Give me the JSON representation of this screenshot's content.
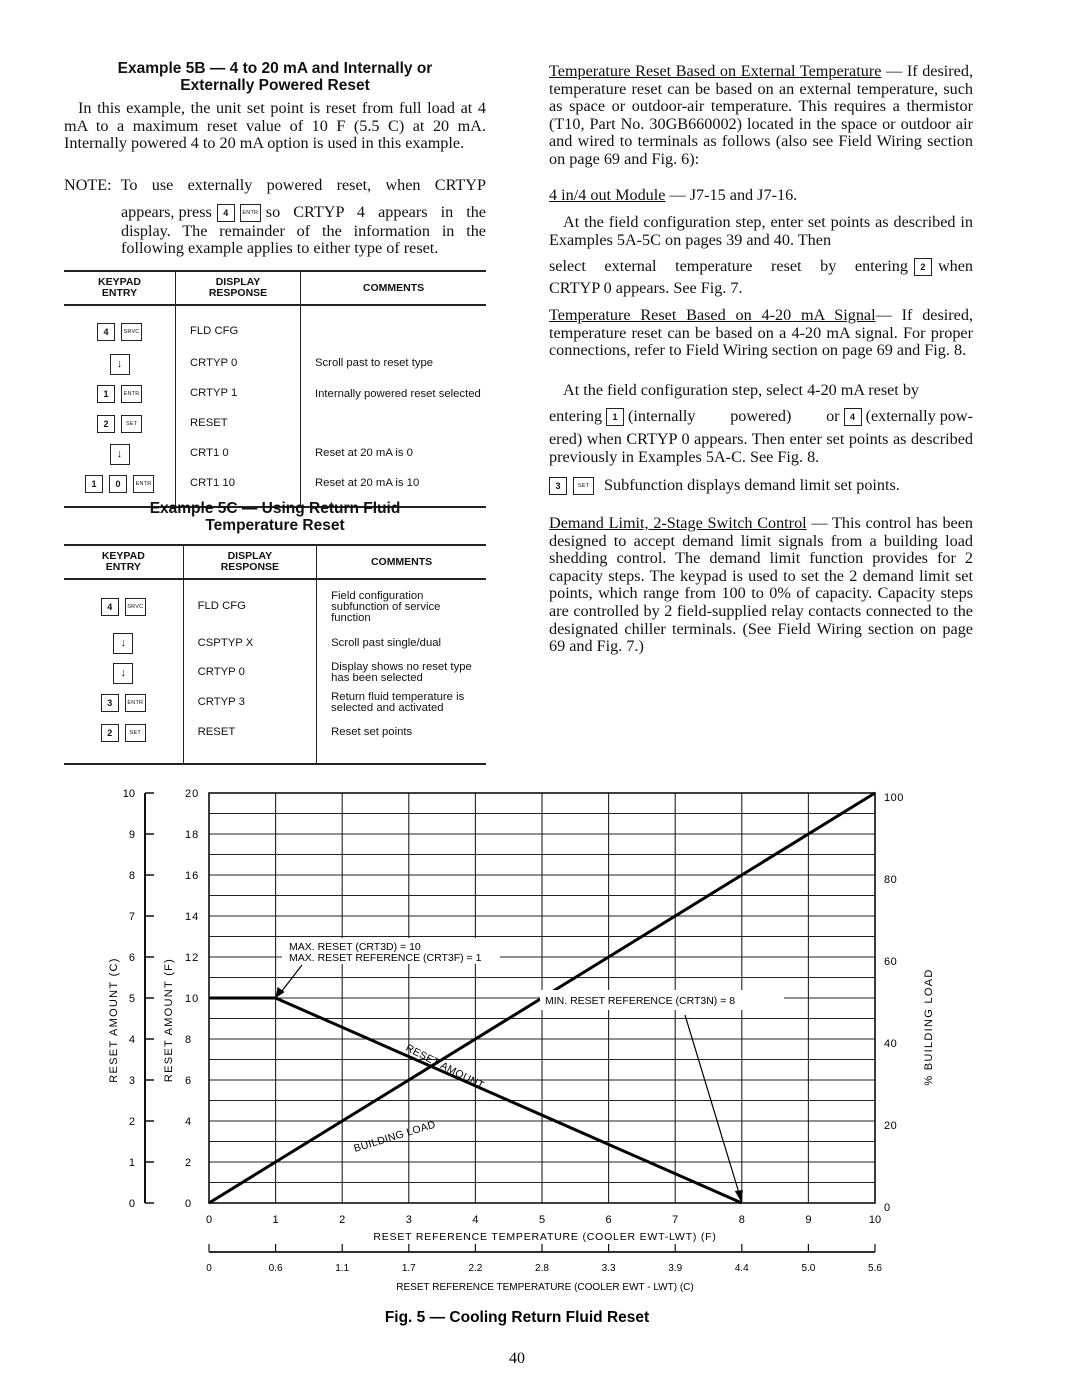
{
  "left": {
    "example5b": {
      "title_line1": "Example 5B — 4 to 20 mA and Internally or",
      "title_line2": "Externally Powered Reset",
      "para1": "In this example, the unit set point is reset from full load at 4 mA to a maximum reset value of 10 F (5.5 C) at 20 mA. Internally powered 4 to 20 mA option is used in this example.",
      "note_label": "NOTE:",
      "note_first": "To use externally powered reset, when CRTYP",
      "note_pre": "appears, press",
      "note_keys": [
        "4",
        "ENTR"
      ],
      "note_post": "so CRTYP 4 appears in the",
      "note_rest": "display. The remainder of the information in the following example applies to either type of reset.",
      "table": {
        "headers": [
          "KEYPAD\nENTRY",
          "DISPLAY\nRESPONSE",
          "COMMENTS"
        ],
        "header_lines": [
          [
            "KEYPAD",
            "ENTRY"
          ],
          [
            "DISPLAY",
            "RESPONSE"
          ],
          [
            "COMMENTS"
          ]
        ],
        "rows": [
          {
            "keys": [
              "4",
              "SRVC"
            ],
            "display": "FLD CFG",
            "comment": ""
          },
          {
            "keys": [
              "↓"
            ],
            "display": "CRTYP 0",
            "comment": "Scroll past to reset type"
          },
          {
            "keys": [
              "1",
              "ENTR"
            ],
            "display": "CRTYP 1",
            "comment": "Internally powered reset selected"
          },
          {
            "keys": [
              "2",
              "SET"
            ],
            "display": "RESET",
            "comment": ""
          },
          {
            "keys": [
              "↓"
            ],
            "display": "CRT1 0",
            "comment": "Reset at 20 mA is 0"
          },
          {
            "keys": [
              "1",
              "0",
              "ENTR"
            ],
            "display": "CRT1 10",
            "comment": "Reset at 20 mA is 10"
          }
        ]
      }
    },
    "example5c": {
      "title_line1": "Example 5C — Using Return Fluid",
      "title_line2": "Temperature Reset",
      "table": {
        "header_lines": [
          [
            "KEYPAD",
            "ENTRY"
          ],
          [
            "DISPLAY",
            "RESPONSE"
          ],
          [
            "COMMENTS"
          ]
        ],
        "rows": [
          {
            "keys": [
              "4",
              "SRVC"
            ],
            "display": "FLD CFG",
            "comment": "Field configuration subfunction of service function"
          },
          {
            "keys": [
              "↓"
            ],
            "display": "CSPTYP X",
            "comment": "Scroll past single/dual"
          },
          {
            "keys": [
              "↓"
            ],
            "display": "CRTYP 0",
            "comment": "Display shows no reset type has been selected"
          },
          {
            "keys": [
              "3",
              "ENTR"
            ],
            "display": "CRTYP 3",
            "comment": "Return fluid temperature is selected and activated"
          },
          {
            "keys": [
              "2",
              "SET"
            ],
            "display": "RESET",
            "comment": "Reset set points"
          }
        ]
      }
    }
  },
  "right": {
    "ext_temp": {
      "heading": "Temperature Reset Based on External Temperature",
      "body": " — If desired, temperature reset can be based on an external temperature, such as space or outdoor-air temperature. This requires a thermistor (T10, Part No. 30GB660002) located in the space or outdoor air and wired to terminals as follows (also see Field Wiring section on page 69 and Fig. 6):"
    },
    "module": {
      "heading": "4 in/4 out Module",
      "body": " — J7-15 and J7-16."
    },
    "field_config": {
      "body1": "At the field configuration step, enter set points as described in Examples 5A-5C on pages 39 and 40. Then",
      "pre": "select external temperature reset by entering",
      "key": "2",
      "post": "when",
      "tail": "CRTYP 0 appears. See Fig. 7."
    },
    "ma_signal": {
      "heading": "Temperature Reset Based on 4-20 mA Signal",
      "body": "— If desired, temperature reset can be based on a 4-20 mA signal. For proper connections, refer to Field Wiring section on page 69 and Fig. 8.",
      "para2": "At the field configuration step, select 4-20 mA reset by",
      "entering": "entering",
      "key1": "1",
      "mid": "(internally powered) or",
      "key2": "4",
      "post": "(externally pow-",
      "tail": "ered) when CRTYP 0 appears. Then enter set points as described previously in Examples 5A-C. See Fig. 8."
    },
    "subfunction": {
      "keys": [
        "3",
        "SET"
      ],
      "text": "Subfunction displays demand limit set points."
    },
    "demand_limit": {
      "heading": "Demand Limit, 2-Stage Switch Control",
      "body": " — This control has been designed to accept demand limit signals from a building load shedding control. The demand limit function provides for 2 capacity steps. The keypad is used to set the 2 demand limit set points, which range from 100 to 0% of capacity. Capacity steps are controlled by 2 field-supplied relay contacts connected to the designated chiller terminals. (See Field Wiring section on page 69 and Fig. 7.)"
    }
  },
  "chart_data": {
    "type": "line",
    "title": "Fig. 5 — Cooling Return Fluid Reset",
    "xlabel": "RESET REFERENCE TEMPERATURE (COOLER EWT-LWT) (F)",
    "xlabel_secondary": "RESET REFERENCE TEMPERATURE (COOLER EWT - LWT) (C)",
    "ylabel": "RESET AMOUNT (F)",
    "ylabel_secondary": "RESET AMOUNT (C)",
    "ylabel_right": "% BUILDING LOAD",
    "xlim": [
      0,
      10
    ],
    "ylim": [
      0,
      20
    ],
    "x_ticks": [
      "0",
      "1",
      "2",
      "3",
      "4",
      "5",
      "6",
      "7",
      "8",
      "9",
      "10"
    ],
    "x_ticks_c": [
      "0",
      "0.6",
      "1.1",
      "1.7",
      "2.2",
      "2.8",
      "3.3",
      "3.9",
      "4.4",
      "5.0",
      "5.6"
    ],
    "y_ticks_f": [
      "0",
      "2",
      "4",
      "6",
      "8",
      "10",
      "12",
      "14",
      "16",
      "18",
      "20"
    ],
    "y_ticks_c": [
      "0",
      "1",
      "2",
      "3",
      "4",
      "5",
      "6",
      "7",
      "8",
      "9",
      "10"
    ],
    "y_ticks_right": [
      "0",
      "20",
      "40",
      "60",
      "80",
      "100"
    ],
    "grid": true,
    "series": [
      {
        "name": "RESET AMOUNT",
        "x": [
          0,
          1,
          8
        ],
        "y": [
          10,
          10,
          0
        ]
      },
      {
        "name": "BUILDING LOAD",
        "x": [
          0,
          10
        ],
        "y": [
          0,
          100
        ],
        "axis": "right"
      }
    ],
    "annotations": [
      {
        "text": "MAX. RESET (CRT3D) = 10",
        "points_to": [
          1,
          10
        ]
      },
      {
        "text": "MAX. RESET REFERENCE (CRT3F) = 1",
        "points_to": [
          1,
          10
        ]
      },
      {
        "text": "MIN. RESET REFERENCE (CRT3N) = 8",
        "points_to": [
          8,
          0
        ]
      }
    ]
  },
  "page_number": "40"
}
